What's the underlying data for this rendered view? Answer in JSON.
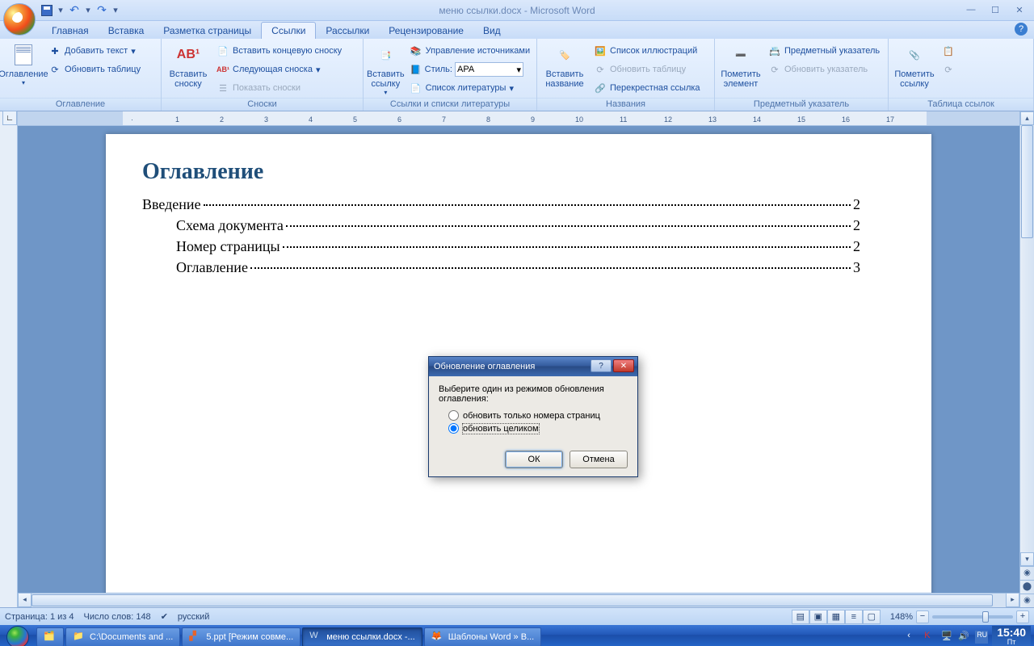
{
  "title": "меню ссылки.docx - Microsoft Word",
  "qat": {
    "save": "Сохранить",
    "undo": "↶",
    "redo": "↷"
  },
  "tabs": [
    "Главная",
    "Вставка",
    "Разметка страницы",
    "Ссылки",
    "Рассылки",
    "Рецензирование",
    "Вид"
  ],
  "active_tab_index": 3,
  "ribbon": {
    "toc": {
      "label": "Оглавление",
      "big": "Оглавление",
      "add_text": "Добавить текст",
      "update": "Обновить таблицу"
    },
    "footnotes": {
      "label": "Сноски",
      "big": "Вставить сноску",
      "ab": "AB¹",
      "endnote": "Вставить концевую сноску",
      "next": "Следующая сноска",
      "show": "Показать сноски"
    },
    "citations": {
      "label": "Ссылки и списки литературы",
      "big": "Вставить ссылку",
      "manage": "Управление источниками",
      "style_label": "Стиль:",
      "style_value": "APA",
      "biblio": "Список литературы"
    },
    "captions": {
      "label": "Названия",
      "big": "Вставить название",
      "list": "Список иллюстраций",
      "update": "Обновить таблицу",
      "cross": "Перекрестная ссылка"
    },
    "index": {
      "label": "Предметный указатель",
      "big": "Пометить элемент",
      "insert": "Предметный указатель",
      "update": "Обновить указатель"
    },
    "toa": {
      "label": "Таблица ссылок",
      "big": "Пометить ссылку"
    }
  },
  "document": {
    "toc_title": "Оглавление",
    "entries": [
      {
        "text": "Введение",
        "page": "2",
        "indent": false
      },
      {
        "text": "Схема документа",
        "page": "2",
        "indent": true
      },
      {
        "text": "Номер страницы",
        "page": "2",
        "indent": true
      },
      {
        "text": "Оглавление",
        "page": "3",
        "indent": true
      }
    ]
  },
  "dialog": {
    "title": "Обновление оглавления",
    "prompt": "Выберите один из режимов обновления оглавления:",
    "opt1": "обновить только номера страниц",
    "opt2": "обновить целиком",
    "ok": "ОК",
    "cancel": "Отмена"
  },
  "status": {
    "page": "Страница: 1 из 4",
    "words": "Число слов: 148",
    "lang": "русский",
    "zoom": "148%"
  },
  "taskbar": {
    "items": [
      {
        "label": "",
        "icon": "explorer"
      },
      {
        "label": "C:\\Documents and ...",
        "icon": "folder"
      },
      {
        "label": "5.ppt [Режим совме...",
        "icon": "ppt"
      },
      {
        "label": "меню ссылки.docx -...",
        "icon": "word",
        "active": true
      },
      {
        "label": "Шаблоны Word » В...",
        "icon": "firefox"
      }
    ],
    "time": "15:40",
    "day": "Пт"
  }
}
